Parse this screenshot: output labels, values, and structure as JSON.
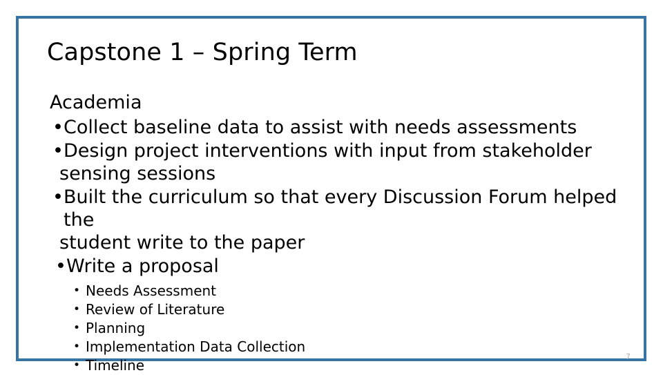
{
  "slide": {
    "title": "Capstone 1 – Spring Term",
    "lead_line": "Academia",
    "bullet_char": "•",
    "bullets": [
      {
        "line1": "Collect baseline data to assist with needs assessments",
        "line2": ""
      },
      {
        "line1": "Design project interventions with input from stakeholder",
        "line2": "sensing sessions"
      },
      {
        "line1": "Built the curriculum so that every Discussion Forum helped the",
        "line2": "student write to the paper"
      },
      {
        "line1": "Write a proposal",
        "line2": ""
      }
    ],
    "sub_bullets": [
      "Needs Assessment",
      "Review of Literature",
      "Planning",
      "Implementation Data Collection",
      "Timeline"
    ],
    "page_number": "7",
    "frame_color": "#3574A5",
    "text_color": "#000000",
    "page_number_color": "#b0b0b0"
  }
}
